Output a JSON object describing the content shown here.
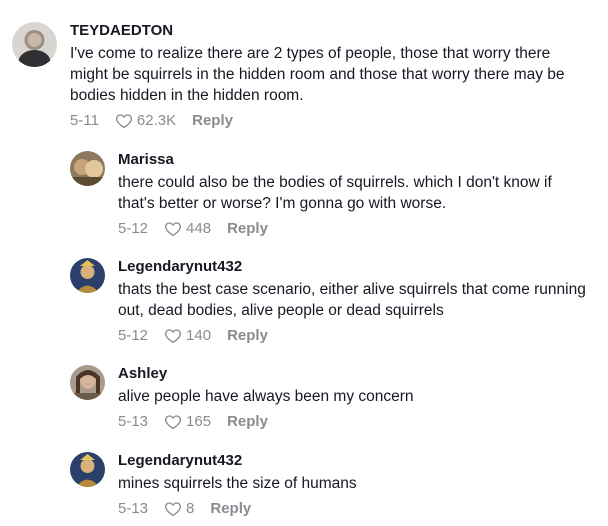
{
  "comments": [
    {
      "username": "TEYDAEDTON",
      "text": "I've come to realize there are 2 types of people, those that worry there might be squirrels in the hidden room and those that worry there may be bodies hidden in the hidden room.",
      "date": "5-11",
      "likes": "62.3K",
      "reply_label": "Reply"
    },
    {
      "username": "Marissa",
      "text": "there could also be the bodies of squirrels. which I don't know if that's better or worse? I'm gonna go with worse.",
      "date": "5-12",
      "likes": "448",
      "reply_label": "Reply"
    },
    {
      "username": "Legendarynut432",
      "text": "thats the best case scenario, either alive squirrels that come running out, dead bodies, alive people or dead squirrels",
      "date": "5-12",
      "likes": "140",
      "reply_label": "Reply"
    },
    {
      "username": "Ashley",
      "text": "alive people have always been my concern",
      "date": "5-13",
      "likes": "165",
      "reply_label": "Reply"
    },
    {
      "username": "Legendarynut432",
      "text": "mines squirrels the size of humans",
      "date": "5-13",
      "likes": "8",
      "reply_label": "Reply"
    }
  ]
}
